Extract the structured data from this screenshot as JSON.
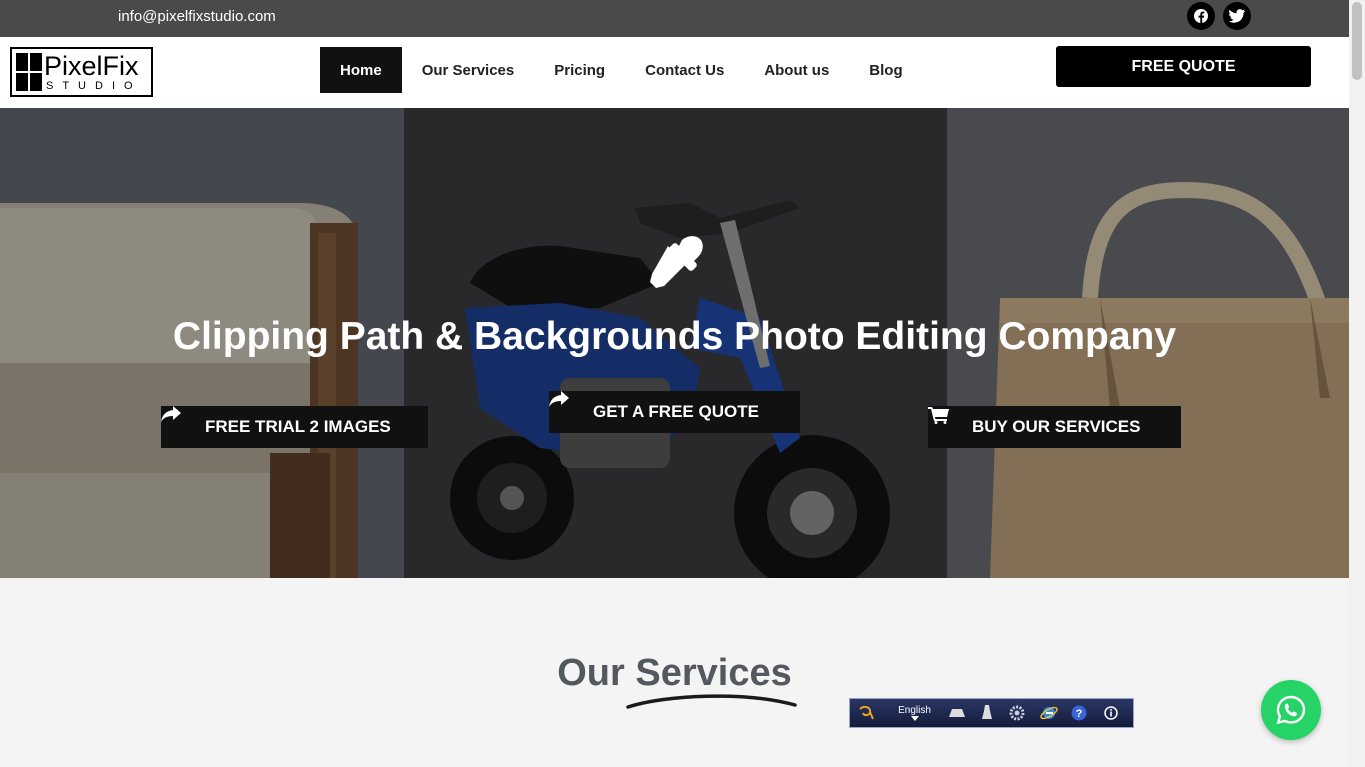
{
  "topbar": {
    "email": "info@pixelfixstudio.com",
    "social_icons": [
      "facebook-icon",
      "twitter-icon"
    ]
  },
  "header": {
    "logo": {
      "word": "PixelFix",
      "sub": "STUDIO"
    },
    "nav": [
      {
        "label": "Home",
        "active": true
      },
      {
        "label": "Our Services",
        "active": false
      },
      {
        "label": "Pricing",
        "active": false
      },
      {
        "label": "Contact Us",
        "active": false
      },
      {
        "label": "About us",
        "active": false
      },
      {
        "label": "Blog",
        "active": false
      }
    ],
    "quote_button": "FREE QUOTE"
  },
  "hero": {
    "icon": "eyedropper-icon",
    "title": "Clipping Path & Backgrounds Photo Editing Company",
    "buttons": {
      "trial": "FREE TRIAL 2 IMAGES",
      "quote": "GET A FREE QUOTE",
      "buy": "BUY OUR SERVICES"
    }
  },
  "services": {
    "heading_part1": "Our ",
    "heading_part2": "Services"
  },
  "ime_toolbar": {
    "language": "English"
  },
  "colors": {
    "topbar": "#4a4a4a",
    "dark_button": "#111111",
    "heading": "#54595f",
    "whatsapp": "#25d366"
  }
}
